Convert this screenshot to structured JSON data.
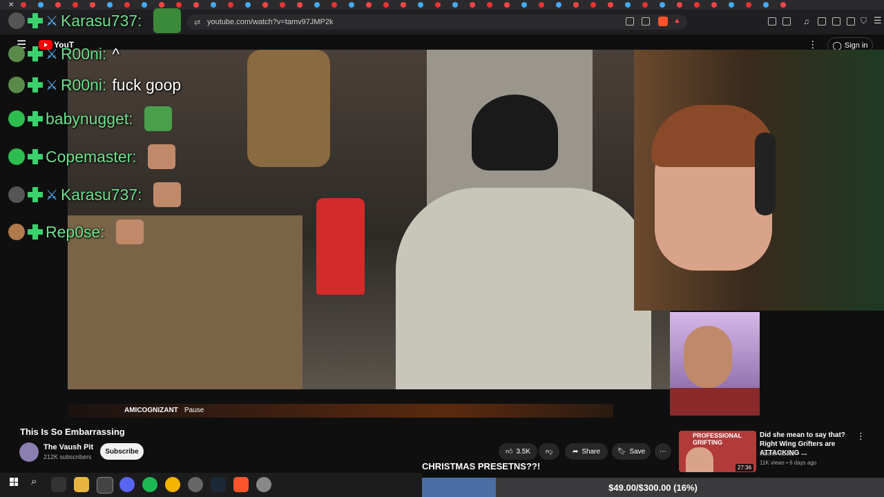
{
  "browser": {
    "url": "youtube.com/watch?v=tamv97JMP2k"
  },
  "youtube": {
    "logo_text": "YouT",
    "sign_in_label": "Sign in",
    "video_title": "This Is So Embarrassing",
    "channel_name": "The Vaush Pit",
    "subscriber_count": "212K subscribers",
    "subscribe_label": "Subscribe",
    "like_count": "3.5K",
    "share_label": "Share",
    "save_label": "Save",
    "now_playing": "AMICOGNIZANT",
    "now_playing_state": "Pause"
  },
  "chat": [
    {
      "username": "Karasu737:",
      "message": "",
      "has_emote": true,
      "avatar_color": "#555"
    },
    {
      "username": "R00ni:",
      "message": "^",
      "has_emote": false,
      "avatar_color": "#5a8a4a"
    },
    {
      "username": "R00ni:",
      "message": "fuck goop",
      "has_emote": false,
      "avatar_color": "#5a8a4a"
    },
    {
      "username": "babynugget:",
      "message": "",
      "has_emote": true,
      "avatar_color": "#2dbd4f"
    },
    {
      "username": "Copemaster:",
      "message": "",
      "has_emote": true,
      "avatar_color": "#2dbd4f"
    },
    {
      "username": "Karasu737:",
      "message": "",
      "has_emote": true,
      "avatar_color": "#555"
    },
    {
      "username": "Rep0se:",
      "message": "",
      "has_emote": true,
      "avatar_color": "#b07a4a"
    }
  ],
  "recommendation": {
    "thumb_text": "PROFESSIONAL GRIFTING",
    "title": "Did she mean to say that? Right Wing Grifters are ATTACKING ...",
    "channel": "Valenti Videos",
    "meta": "11K views • 6 days ago",
    "duration": "27:36"
  },
  "overlay": {
    "christmas_text": "CHRISTMAS PRESETNS??!",
    "goal_text": "$49.00/$300.00 (16%)",
    "goal_fraction": 0.16
  },
  "colors": {
    "accent_green": "#3bd16f",
    "youtube_red": "#ff0000",
    "goal_fill": "#4a6fa5"
  }
}
